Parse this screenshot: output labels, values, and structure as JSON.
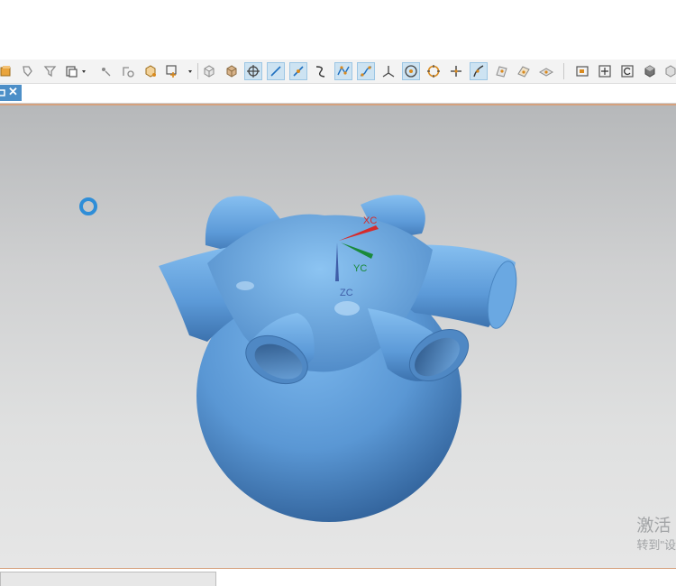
{
  "toolbar": {
    "icons": [
      {
        "name": "part-navigator-icon",
        "color": "#d98a1e"
      },
      {
        "name": "selection-filter-icon",
        "color": "#8a8a8a"
      },
      {
        "name": "funnel-filter-icon",
        "color": "#8a8a8a"
      },
      {
        "name": "snap-dropdown-icon",
        "color": "#555555"
      },
      {
        "name": "pick-point-icon",
        "color": "#8a8a8a"
      },
      {
        "name": "pick-face-icon",
        "color": "#8a8a8a"
      },
      {
        "name": "box-select-icon",
        "color": "#d98a1e"
      },
      {
        "name": "show-hide-dropdown-icon",
        "color": "#555555"
      },
      {
        "name": "cube-wire-icon",
        "color": "#8a8a8a"
      },
      {
        "name": "cube-shaded-icon",
        "color": "#b08a60"
      },
      {
        "name": "snap-crosshair-icon",
        "color": "#444444"
      },
      {
        "name": "line-icon",
        "color": "#1f6fbf"
      },
      {
        "name": "line-point-icon",
        "color": "#1f6fbf"
      },
      {
        "name": "curve-icon",
        "color": "#d98a1e"
      },
      {
        "name": "polyline-icon",
        "color": "#d98a1e"
      },
      {
        "name": "spline-icon",
        "color": "#d98a1e"
      },
      {
        "name": "intersection-icon",
        "color": "#444444"
      },
      {
        "name": "center-point-icon",
        "color": "#d98a1e"
      },
      {
        "name": "quadrant-point-icon",
        "color": "#d98a1e"
      },
      {
        "name": "plus-point-icon",
        "color": "#d98a1e"
      },
      {
        "name": "point-on-curve-icon",
        "color": "#1f6fbf"
      },
      {
        "name": "point-on-face-icon",
        "color": "#8a8a8a"
      },
      {
        "name": "surface-point-icon",
        "color": "#8a8a8a"
      },
      {
        "name": "plane-icon",
        "color": "#8a8a8a"
      },
      {
        "name": "zoom-window-icon",
        "color": "#555555"
      },
      {
        "name": "pan-icon",
        "color": "#555555"
      },
      {
        "name": "rotate-icon",
        "color": "#555555"
      },
      {
        "name": "shaded-view-icon",
        "color": "#555555"
      },
      {
        "name": "render-style-icon",
        "color": "#8a8a8a"
      }
    ]
  },
  "viewport": {
    "model_color": "#5f9fdc",
    "triad": {
      "x_label": "XC",
      "y_label": "YC",
      "z_label": "ZC",
      "x_color": "#d62b2b",
      "y_color": "#1a8a3a",
      "z_color": "#3f5ea8"
    }
  },
  "watermark": {
    "line1": "激活",
    "line2": "转到\"设"
  }
}
